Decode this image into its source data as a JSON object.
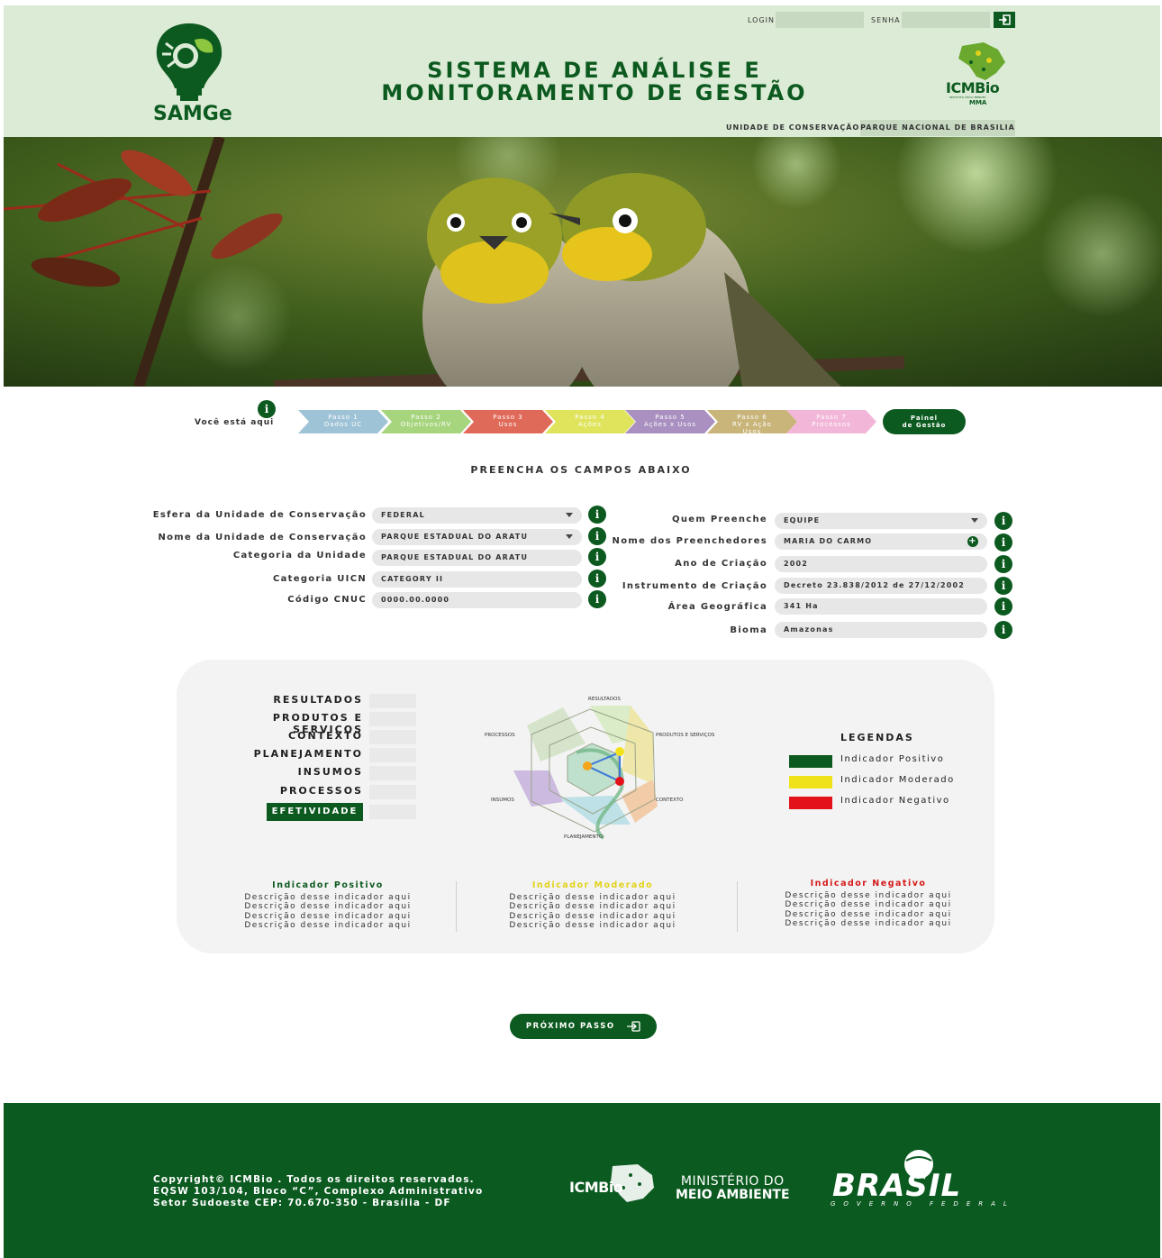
{
  "header": {
    "app_name": "SAMGe",
    "title_line1": "SISTEMA DE ANÁLISE E",
    "title_line2": "MONITORAMENTO DE GESTÃO",
    "login_label": "LOGIN",
    "senha_label": "SENHA",
    "login_value": "",
    "senha_value": "",
    "icmbio_logo_text": "ICMBio",
    "icmbio_sub": "INSTITUTO CHICO MENDES",
    "icmbio_mma": "MMA",
    "uc_label": "UNIDADE DE CONSERVAÇÃO:",
    "uc_value": "PARQUE NACIONAL DE BRASILIA"
  },
  "steps": {
    "you_are_here": "Você está aqui",
    "items": [
      {
        "l1": "Passo 1",
        "l2": "Dados UC",
        "l3": "",
        "color": "#9fc3d6"
      },
      {
        "l1": "Passo 2",
        "l2": "Objetivos/RV",
        "l3": "",
        "color": "#a7d57e"
      },
      {
        "l1": "Passo 3",
        "l2": "Usos",
        "l3": "",
        "color": "#e06a5a"
      },
      {
        "l1": "Passo 4",
        "l2": "Ações",
        "l3": "",
        "color": "#dfe45c"
      },
      {
        "l1": "Passo 5",
        "l2": "Ações x Usos",
        "l3": "",
        "color": "#a990c0"
      },
      {
        "l1": "Passo 6",
        "l2": "RV x Ação",
        "l3": "Usos",
        "color": "#c9b57a"
      },
      {
        "l1": "Passo 7",
        "l2": "Processos",
        "l3": "",
        "color": "#f2b7d8"
      }
    ],
    "final_l1": "Painel",
    "final_l2": "de Gestão"
  },
  "form": {
    "section_title": "PREENCHA OS CAMPOS ABAIXO",
    "left": [
      {
        "label": "Esfera da Unidade de Conservação",
        "value": "FEDERAL"
      },
      {
        "label": "Nome da Unidade de Conservação",
        "value": "PARQUE ESTADUAL DO ARATU"
      },
      {
        "label": "Categoria da Unidade",
        "value": "PARQUE ESTADUAL DO ARATU"
      },
      {
        "label": "Categoria UICN",
        "value": "CATEGORY II"
      },
      {
        "label": "Código CNUC",
        "value": "0000.00.0000"
      }
    ],
    "right": [
      {
        "label": "Quem Preenche",
        "value": "EQUIPE"
      },
      {
        "label": "Nome dos Preenchedores",
        "value": "MARIA DO CARMO"
      },
      {
        "label": "Ano de Criação",
        "value": "2002"
      },
      {
        "label": "Instrumento de Criação",
        "value": "Decreto 23.838/2012 de 27/12/2002"
      },
      {
        "label": "Área Geográfica",
        "value": "341 Ha"
      },
      {
        "label": "Bioma",
        "value": "Amazonas"
      }
    ]
  },
  "panel": {
    "categories": [
      "RESULTADOS",
      "PRODUTOS E SERVIÇOS",
      "CONTEXTO",
      "PLANEJAMENTO",
      "INSUMOS",
      "PROCESSOS"
    ],
    "active_category": "EFETIVIDADE",
    "radar_labels": {
      "top": "RESULTADOS",
      "top_right": "PRODUTOS E SERVIÇOS",
      "bottom_right": "CONTEXTO",
      "bottom": "PLANEJAMENTO",
      "bottom_left": "INSUMOS",
      "top_left": "PROCESSOS"
    },
    "legend_title": "LEGENDAS",
    "legend": [
      {
        "label": "Indicador Positivo",
        "color": "#0c5a1f"
      },
      {
        "label": "Indicador Moderado",
        "color": "#f0e21a"
      },
      {
        "label": "Indicador Negativo",
        "color": "#e3121a"
      }
    ],
    "descriptions": [
      {
        "heading": "Indicador Positivo",
        "color": "#0c5a1f",
        "lines": [
          "Descrição desse indicador aqui",
          "Descrição desse indicador aqui",
          "Descrição desse indicador aqui",
          "Descrição desse indicador aqui"
        ]
      },
      {
        "heading": "Indicador Moderado",
        "color": "#e3d21a",
        "lines": [
          "Descrição desse indicador aqui",
          "Descrição desse indicador aqui",
          "Descrição desse indicador aqui",
          "Descrição desse indicador aqui"
        ]
      },
      {
        "heading": "Indicador Negativo",
        "color": "#d51a1a",
        "lines": [
          "Descrição desse indicador aqui",
          "Descrição desse indicador aqui",
          "Descrição desse indicador aqui",
          "Descrição desse indicador aqui"
        ]
      }
    ]
  },
  "next_button": "PRÓXIMO PASSO",
  "footer": {
    "copy1": "Copyright© ICMBio . Todos os direitos reservados.",
    "copy2": "EQSW 103/104, Bloco “C”, Complexo Administrativo",
    "copy3": "Setor Sudoeste CEP: 70.670-350 - Brasília - DF",
    "icmbio": "ICMBio",
    "min1": "MINISTÉRIO DO",
    "min2": "MEIO AMBIENTE",
    "brasil": "BRASIL",
    "gov": "GOVERNO FEDERAL"
  }
}
